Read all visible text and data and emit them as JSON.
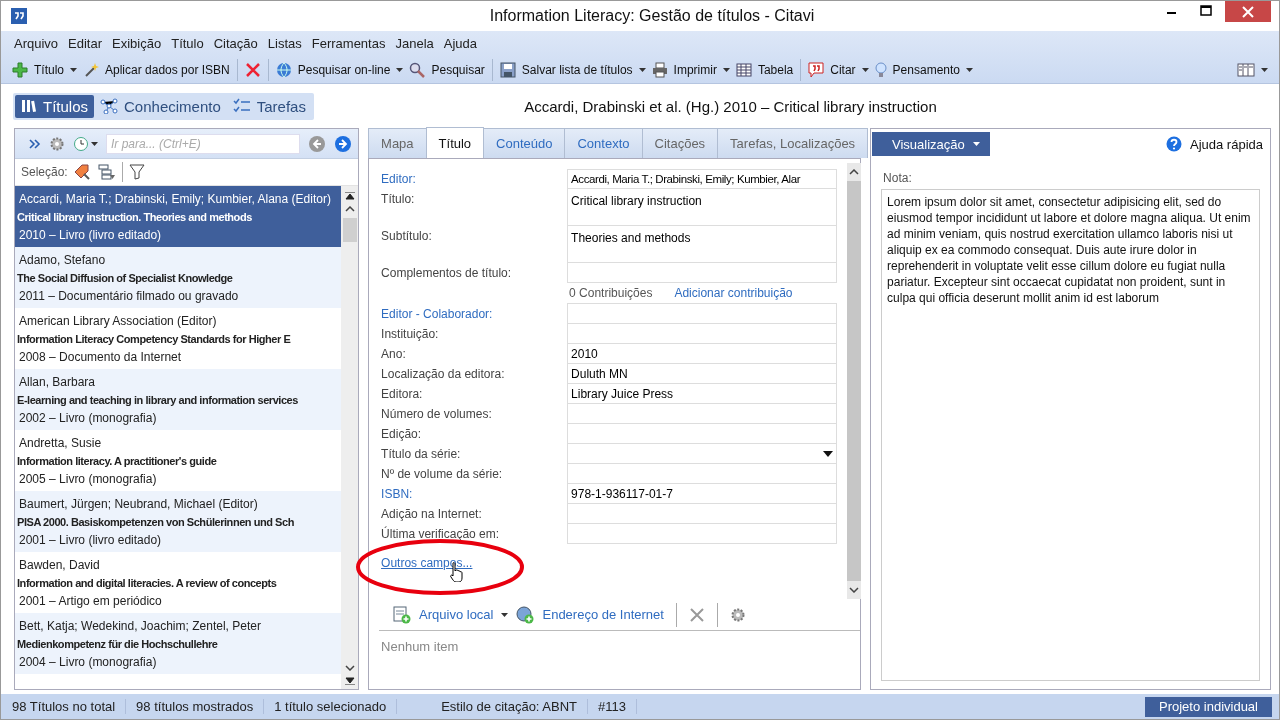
{
  "window": {
    "title": "Information Literacy: Gestão de títulos - Citavi"
  },
  "menu": [
    "Arquivo",
    "Editar",
    "Exibição",
    "Título",
    "Citação",
    "Listas",
    "Ferramentas",
    "Janela",
    "Ajuda"
  ],
  "toolbar": [
    {
      "kind": "plus",
      "label": "Título",
      "dropdown": true
    },
    {
      "kind": "wand",
      "label": "Aplicar dados por ISBN",
      "dropdown": false
    },
    {
      "kind": "sep"
    },
    {
      "kind": "delete",
      "dropdown": false
    },
    {
      "kind": "sep"
    },
    {
      "kind": "globe",
      "label": "Pesquisar on-line",
      "dropdown": true
    },
    {
      "kind": "search",
      "label": "Pesquisar",
      "dropdown": false
    },
    {
      "kind": "sep"
    },
    {
      "kind": "save",
      "label": "Salvar lista de títulos",
      "dropdown": true
    },
    {
      "kind": "print",
      "label": "Imprimir",
      "dropdown": true
    },
    {
      "kind": "table",
      "label": "Tabela",
      "dropdown": false
    },
    {
      "kind": "sep"
    },
    {
      "kind": "quote",
      "label": "Citar",
      "dropdown": true
    },
    {
      "kind": "bulb",
      "label": "Pensamento",
      "dropdown": true
    }
  ],
  "views": [
    {
      "kind": "books",
      "label": "Títulos",
      "selected": true
    },
    {
      "kind": "network",
      "label": "Conhecimento",
      "selected": false
    },
    {
      "kind": "tasks",
      "label": "Tarefas",
      "selected": false
    }
  ],
  "reference_heading": "Accardi, Drabinski et al. (Hg.) 2010 – Critical library instruction",
  "left": {
    "search": {
      "placeholder": "Ir para... (Ctrl+E)"
    },
    "selection_label": "Seleção:",
    "items": [
      {
        "authors": "Accardi, Maria T.; Drabinski, Emily; Kumbier, Alana (Editor)",
        "title": "Critical library instruction. Theories and methods",
        "meta": "2010 – Livro (livro editado)",
        "selected": true
      },
      {
        "authors": "Adamo, Stefano",
        "title": "The Social Diffusion of Specialist Knowledge",
        "meta": "2011 – Documentário filmado ou gravado",
        "selected": false
      },
      {
        "authors": "American Library Association (Editor)",
        "title": "Information Literacy Competency Standards for Higher E",
        "meta": "2008 – Documento da Internet",
        "selected": false
      },
      {
        "authors": "Allan, Barbara",
        "title": "E-learning and teaching in library and information services",
        "meta": "2002 – Livro (monografia)",
        "selected": false
      },
      {
        "authors": "Andretta, Susie",
        "title": "Information literacy. A practitioner's guide",
        "meta": "2005 – Livro (monografia)",
        "selected": false
      },
      {
        "authors": "Baumert, Jürgen; Neubrand, Michael (Editor)",
        "title": "PISA 2000. Basiskompetenzen von Schülerinnen und Sch",
        "meta": "2001 – Livro (livro editado)",
        "selected": false
      },
      {
        "authors": "Bawden, David",
        "title": "Information and digital literacies. A review of concepts",
        "meta": "2001 – Artigo em periódico",
        "selected": false
      },
      {
        "authors": "Bett, Katja; Wedekind, Joachim; Zentel, Peter",
        "title": "Medienkompetenz für die Hochschullehre",
        "meta": "2004 – Livro (monografia)",
        "selected": false
      }
    ]
  },
  "tabs": [
    {
      "label": "Mapa",
      "selected": false
    },
    {
      "label": "Título",
      "selected": true
    },
    {
      "label": "Conteúdo",
      "selected": false
    },
    {
      "label": "Contexto",
      "selected": false
    },
    {
      "label": "Citações",
      "selected": false
    },
    {
      "label": "Tarefas, Localizações",
      "selected": false
    }
  ],
  "form": [
    {
      "kind": "text",
      "label": "Editor:",
      "link": true,
      "value": "Accardi, Maria T.; Drabinski, Emily; Kumbier, Alar"
    },
    {
      "kind": "multiline",
      "label": "Título:",
      "link": false,
      "value": "Critical library instruction"
    },
    {
      "kind": "multiline",
      "label": "Subtítulo:",
      "link": false,
      "value": "Theories and methods"
    },
    {
      "kind": "text",
      "label": "Complementos de título:",
      "link": false
    },
    {
      "kind": "contrib",
      "count": "0 Contribuições",
      "action": "Adicionar contribuição"
    },
    {
      "kind": "text",
      "label": "Editor - Colaborador:",
      "link": true
    },
    {
      "kind": "text",
      "label": "Instituição:",
      "link": false
    },
    {
      "kind": "text",
      "label": "Ano:",
      "link": false,
      "value": "2010"
    },
    {
      "kind": "text",
      "label": "Localização da editora:",
      "link": false,
      "value": "Duluth MN"
    },
    {
      "kind": "text",
      "label": "Editora:",
      "link": false,
      "value": "Library Juice Press"
    },
    {
      "kind": "text",
      "label": "Número de volumes:",
      "link": false
    },
    {
      "kind": "text",
      "label": "Edição:",
      "link": false
    },
    {
      "kind": "dropdown",
      "label": "Título da série:",
      "link": false
    },
    {
      "kind": "text",
      "label": "Nº de volume da série:",
      "link": false
    },
    {
      "kind": "text",
      "label": "ISBN:",
      "link": true,
      "value": "978-1-936117-01-7"
    },
    {
      "kind": "text",
      "label": "Adição na Internet:",
      "link": false
    },
    {
      "kind": "text",
      "label": "Última verificação em:",
      "link": false
    }
  ],
  "more_fields_link": "Outros campos...",
  "attachments": {
    "buttons": [
      {
        "kind": "file",
        "label": "Arquivo local",
        "dropdown": true
      },
      {
        "kind": "web",
        "label": "Endereço de Internet",
        "dropdown": false
      }
    ],
    "empty": "Nenhum item"
  },
  "right": {
    "menu": "Visualização",
    "help": "Ajuda rápida",
    "note_label": "Nota:",
    "note": "Lorem ipsum dolor sit amet, consectetur adipisicing elit, sed do eiusmod tempor incididunt ut labore et dolore magna aliqua. Ut enim ad minim veniam, quis nostrud exercitation ullamco laboris nisi ut aliquip ex ea commodo consequat. Duis aute irure dolor in reprehenderit in voluptate velit esse cillum dolore eu fugiat nulla pariatur. Excepteur sint occaecat cupidatat non proident, sunt in culpa qui officia deserunt mollit anim id est laborum"
  },
  "status_bar": {
    "items": [
      "98 Títulos no total",
      "98 títulos mostrados",
      "1 título selecionado",
      "Estilo de citação: ABNT",
      "#113"
    ],
    "project": "Projeto individual"
  }
}
